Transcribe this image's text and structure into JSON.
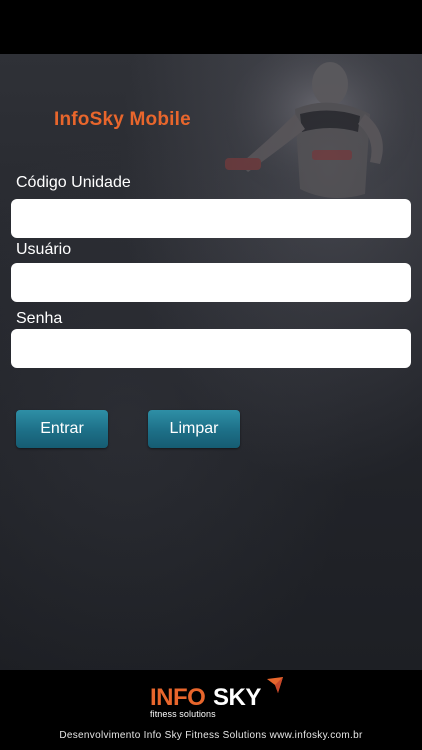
{
  "app": {
    "title": "InfoSky Mobile"
  },
  "form": {
    "unit_code": {
      "label": "Código Unidade",
      "value": "",
      "placeholder": ""
    },
    "username": {
      "label": "Usuário",
      "value": "",
      "placeholder": ""
    },
    "password": {
      "label": "Senha",
      "value": "",
      "placeholder": ""
    }
  },
  "buttons": {
    "login": "Entrar",
    "clear": "Limpar"
  },
  "footer": {
    "logo_info": "INFO",
    "logo_sky": "SKY",
    "logo_tagline": "fitness solutions",
    "credit": "Desenvolvimento Info Sky Fitness Solutions www.infosky.com.br"
  },
  "colors": {
    "accent": "#e8662c",
    "button": "#1d6f87"
  }
}
